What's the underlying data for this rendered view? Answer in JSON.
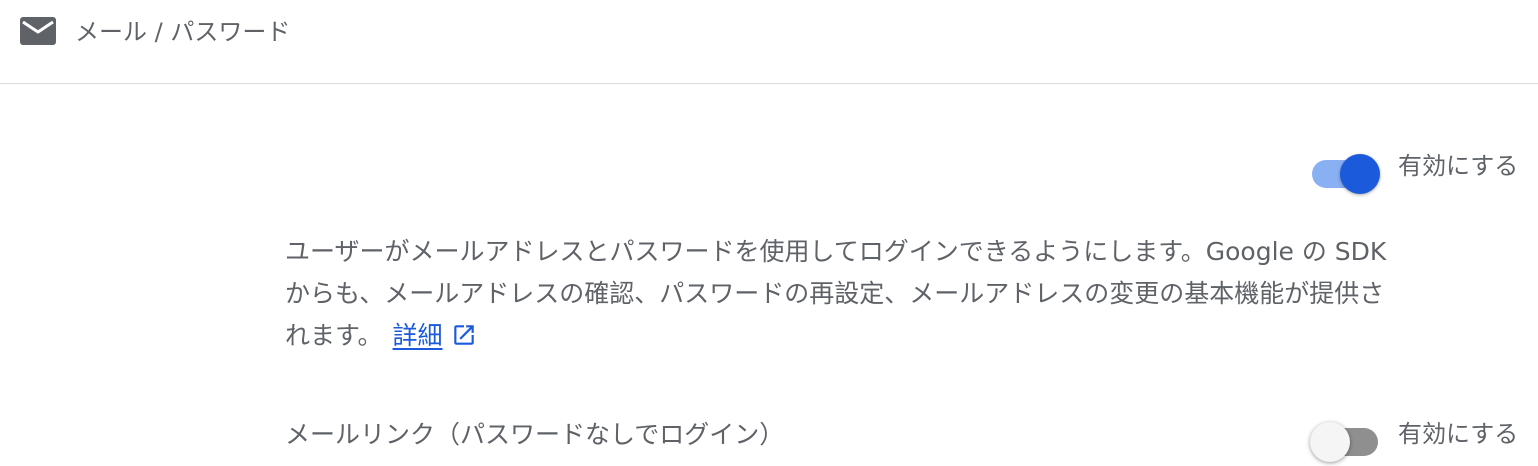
{
  "header": {
    "icon": "mail-icon",
    "title": "メール / パスワード"
  },
  "email_password": {
    "enabled": true,
    "toggle_label": "有効にする",
    "description_lines": [
      "ユーザーがメールアドレスとパスワードを使用してログインできるようにします。Google の SDK",
      "からも、メールアドレスの確認、パスワードの再設定、メールアドレスの変更の基本機能が提供さ",
      "れます。"
    ],
    "learn_more": "詳細",
    "learn_more_icon": "open-in-new-icon"
  },
  "email_link": {
    "label": "メールリンク（パスワードなしでログイン）",
    "enabled": false,
    "toggle_label": "有効にする"
  },
  "colors": {
    "accent": "#1a5adb",
    "accent_track": "#8ab0f4",
    "text": "#5f6368",
    "divider": "#dadce0"
  }
}
